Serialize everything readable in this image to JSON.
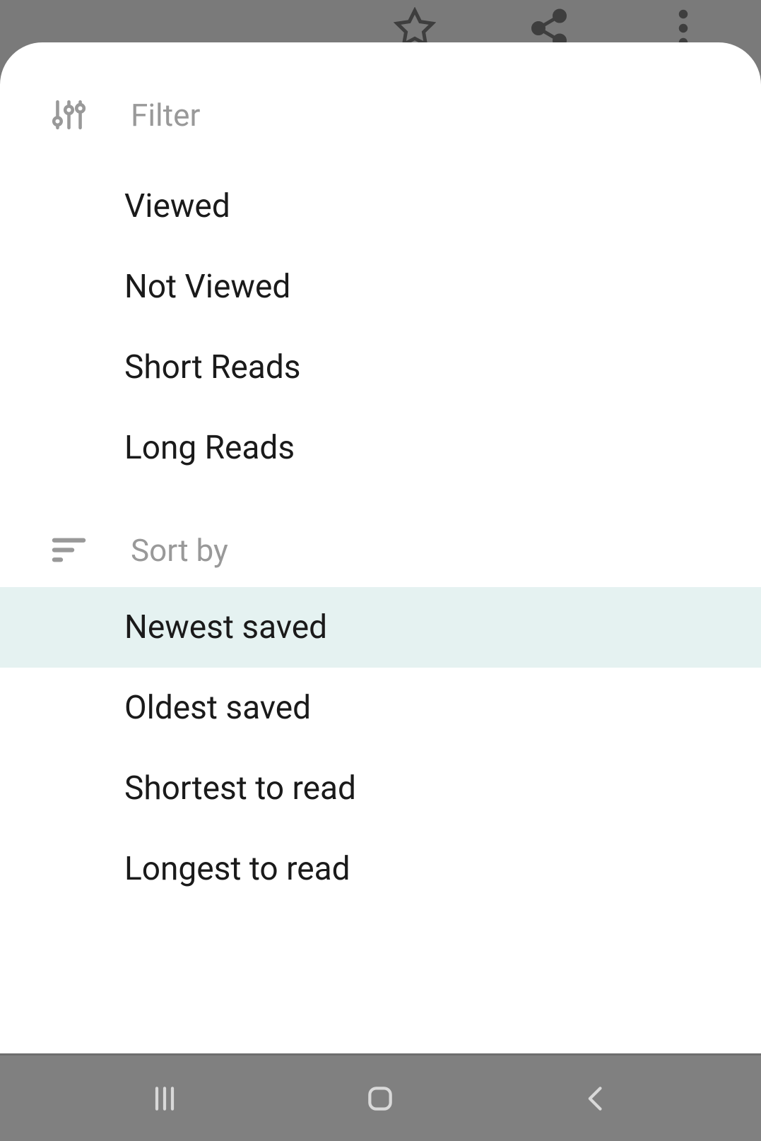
{
  "filter": {
    "header_label": "Filter",
    "options": [
      {
        "label": "Viewed"
      },
      {
        "label": "Not Viewed"
      },
      {
        "label": "Short Reads"
      },
      {
        "label": "Long Reads"
      }
    ]
  },
  "sort": {
    "header_label": "Sort by",
    "options": [
      {
        "label": "Newest saved",
        "selected": true
      },
      {
        "label": "Oldest saved",
        "selected": false
      },
      {
        "label": "Shortest to read",
        "selected": false
      },
      {
        "label": "Longest to read",
        "selected": false
      }
    ]
  }
}
